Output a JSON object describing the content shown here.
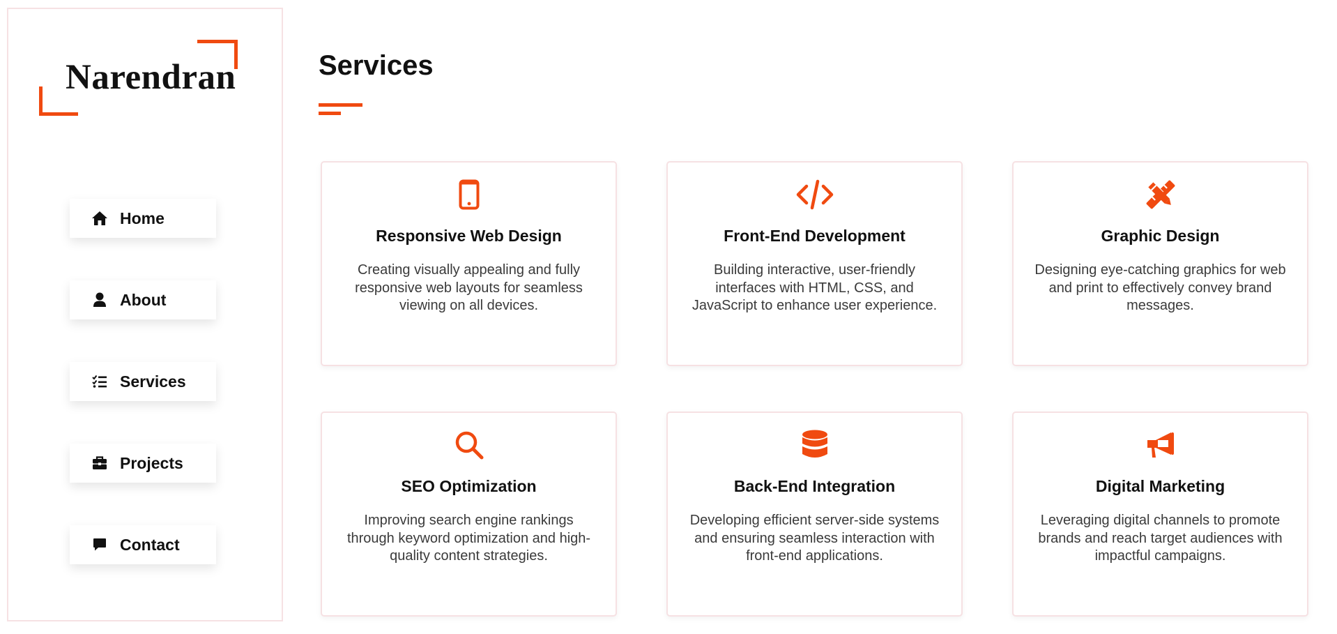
{
  "brand": {
    "name": "Narendran",
    "accent_color": "#f04a10"
  },
  "nav": [
    {
      "label": "Home",
      "icon": "home-icon"
    },
    {
      "label": "About",
      "icon": "user-icon"
    },
    {
      "label": "Services",
      "icon": "checklist-icon"
    },
    {
      "label": "Projects",
      "icon": "briefcase-icon"
    },
    {
      "label": "Contact",
      "icon": "message-icon"
    }
  ],
  "main": {
    "title": "Services"
  },
  "services": [
    {
      "title": "Responsive Web Design",
      "icon": "mobile-icon",
      "description": "Creating visually appealing and fully responsive web layouts for seamless viewing on all devices."
    },
    {
      "title": "Front-End Development",
      "icon": "code-icon",
      "description": "Building interactive, user-friendly interfaces with HTML, CSS, and JavaScript to enhance user experience."
    },
    {
      "title": "Graphic Design",
      "icon": "pencil-ruler-icon",
      "description": "Designing eye-catching graphics for web and print to effectively convey brand messages."
    },
    {
      "title": "SEO Optimization",
      "icon": "search-icon",
      "description": "Improving search engine rankings through keyword optimization and high-quality content strategies."
    },
    {
      "title": "Back-End Integration",
      "icon": "database-icon",
      "description": "Developing efficient server-side systems and ensuring seamless interaction with front-end applications."
    },
    {
      "title": "Digital Marketing",
      "icon": "megaphone-icon",
      "description": "Leveraging digital channels to promote brands and reach target audiences with impactful campaigns."
    }
  ]
}
